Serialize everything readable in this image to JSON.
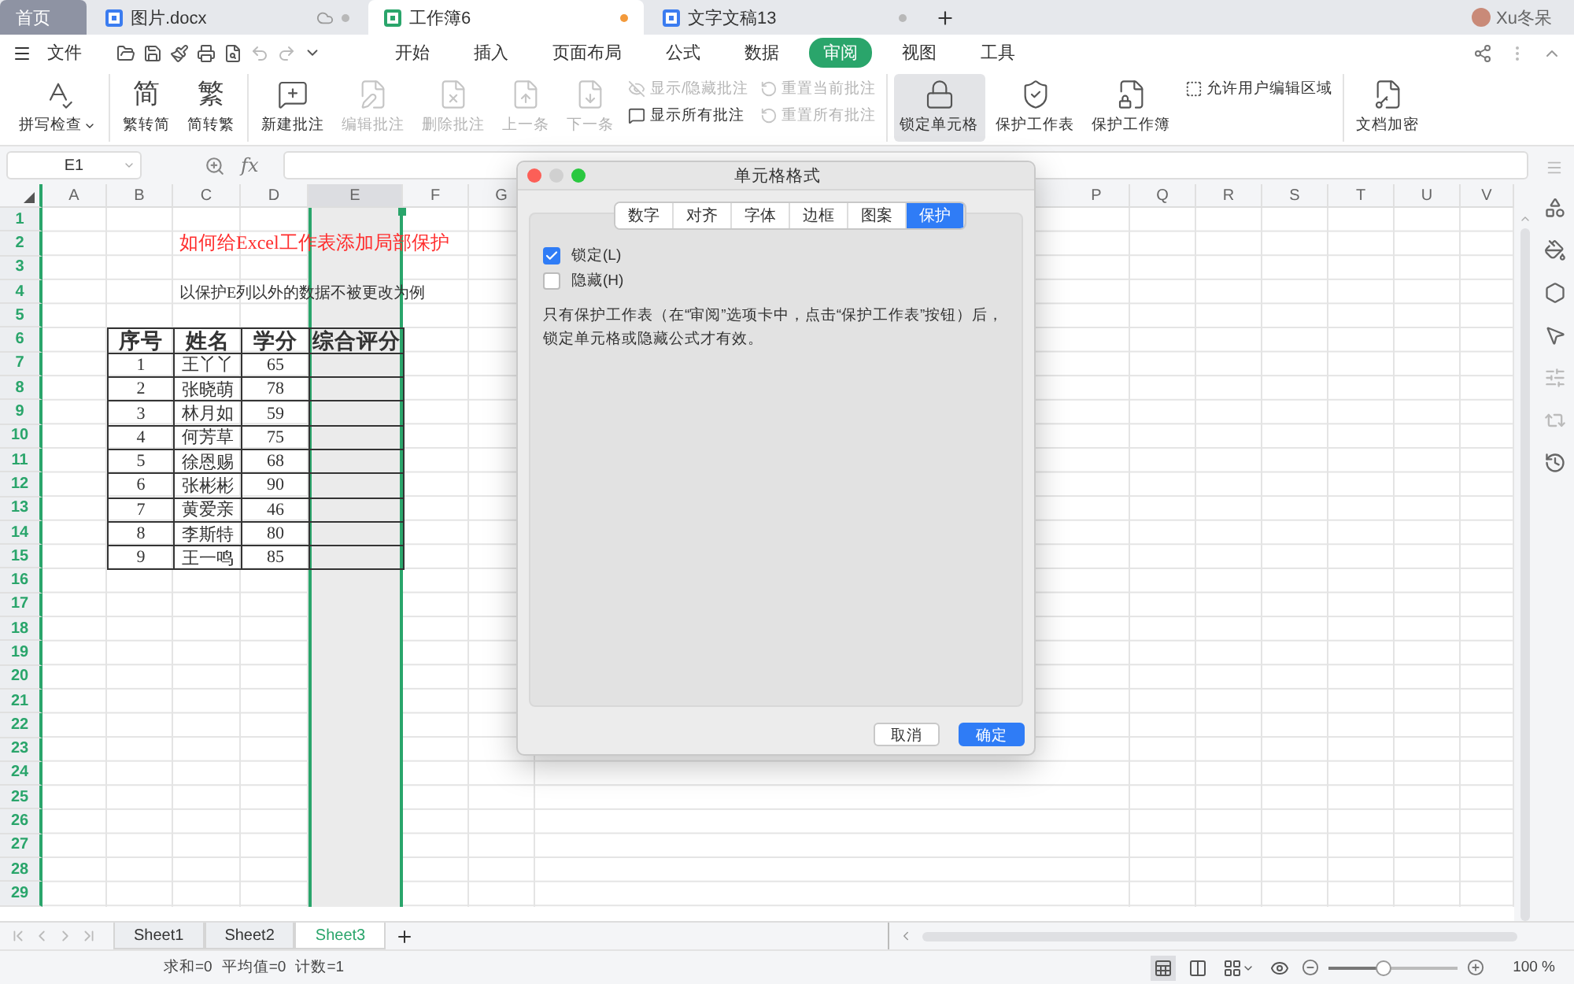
{
  "tabs": [
    {
      "label": "首页",
      "kind": "home",
      "selected": false
    },
    {
      "label": "图片.docx",
      "kind": "doc",
      "selected": false,
      "cloud": true,
      "modified": false
    },
    {
      "label": "工作簿6",
      "kind": "sheet",
      "selected": true,
      "cloud": false,
      "modified": true
    },
    {
      "label": "文字文稿13",
      "kind": "doc",
      "selected": false,
      "cloud": false,
      "modified": false
    }
  ],
  "user": {
    "name": "Xu冬呆"
  },
  "menu": {
    "file": "文件",
    "items": [
      {
        "label": "开始",
        "selected": false
      },
      {
        "label": "插入",
        "selected": false
      },
      {
        "label": "页面布局",
        "selected": false
      },
      {
        "label": "公式",
        "selected": false
      },
      {
        "label": "数据",
        "selected": false
      },
      {
        "label": "审阅",
        "selected": true
      },
      {
        "label": "视图",
        "selected": false
      },
      {
        "label": "工具",
        "selected": false
      }
    ]
  },
  "ribbon": {
    "groups": [
      {
        "items": [
          {
            "kind": "large",
            "label": "拼写检查",
            "dropdown": true,
            "disabled": false,
            "selected": false
          }
        ]
      },
      {
        "items": [
          {
            "kind": "glyph",
            "glyph": "简",
            "label": "繁转简",
            "disabled": false,
            "selected": false
          },
          {
            "kind": "glyph",
            "glyph": "繁",
            "label": "简转繁",
            "disabled": false,
            "selected": false
          }
        ]
      },
      {
        "items": [
          {
            "kind": "large",
            "label": "新建批注",
            "disabled": false,
            "selected": false
          },
          {
            "kind": "large",
            "label": "编辑批注",
            "disabled": true,
            "selected": false
          },
          {
            "kind": "large",
            "label": "删除批注",
            "disabled": true,
            "selected": false
          },
          {
            "kind": "large",
            "label": "上一条",
            "disabled": true,
            "selected": false
          },
          {
            "kind": "large",
            "label": "下一条",
            "disabled": true,
            "selected": false
          },
          {
            "kind": "stack",
            "items": [
              {
                "label": "显示/隐藏批注",
                "disabled": true
              },
              {
                "label": "显示所有批注",
                "disabled": false
              }
            ]
          },
          {
            "kind": "stack",
            "items": [
              {
                "label": "重置当前批注",
                "disabled": true
              },
              {
                "label": "重置所有批注",
                "disabled": true
              }
            ]
          }
        ]
      },
      {
        "items": [
          {
            "kind": "large",
            "label": "锁定单元格",
            "disabled": false,
            "selected": true
          },
          {
            "kind": "large",
            "label": "保护工作表",
            "disabled": false,
            "selected": false
          },
          {
            "kind": "large",
            "label": "保护工作簿",
            "disabled": false,
            "selected": false
          },
          {
            "kind": "stack",
            "items": [
              {
                "label": "允许用户编辑区域",
                "disabled": false
              }
            ]
          }
        ]
      },
      {
        "items": [
          {
            "kind": "large",
            "label": "文档加密",
            "disabled": false,
            "selected": false
          }
        ]
      }
    ]
  },
  "formula_bar": {
    "cell": "E1",
    "fx": "fx"
  },
  "sheet": {
    "columns_left": [
      {
        "label": "A",
        "selected": false
      },
      {
        "label": "B",
        "selected": false
      },
      {
        "label": "C",
        "selected": false
      },
      {
        "label": "D",
        "selected": false
      },
      {
        "label": "E",
        "selected": true
      },
      {
        "label": "F",
        "selected": false
      },
      {
        "label": "G",
        "selected": false
      }
    ],
    "columns_right": [
      {
        "label": "P",
        "selected": false
      },
      {
        "label": "Q",
        "selected": false
      },
      {
        "label": "R",
        "selected": false
      },
      {
        "label": "S",
        "selected": false
      },
      {
        "label": "T",
        "selected": false
      },
      {
        "label": "U",
        "selected": false
      },
      {
        "label": "V",
        "selected": false
      }
    ],
    "rows": [
      "1",
      "2",
      "3",
      "4",
      "5",
      "6",
      "7",
      "8",
      "9",
      "10",
      "11",
      "12",
      "13",
      "14",
      "15",
      "16",
      "17",
      "18",
      "19",
      "20",
      "21",
      "22",
      "23",
      "24",
      "25",
      "26",
      "27",
      "28",
      "29"
    ],
    "title": "如何给Excel工作表添加局部保护",
    "note": "以保护E列以外的数据不被更改为例",
    "table": {
      "header": [
        "序号",
        "姓名",
        "学分",
        "综合评分"
      ],
      "rows": [
        [
          "1",
          "王丫丫",
          "65"
        ],
        [
          "2",
          "张晓萌",
          "78"
        ],
        [
          "3",
          "林月如",
          "59"
        ],
        [
          "4",
          "何芳草",
          "75"
        ],
        [
          "5",
          "徐恩赐",
          "68"
        ],
        [
          "6",
          "张彬彬",
          "90"
        ],
        [
          "7",
          "黄爱亲",
          "46"
        ],
        [
          "8",
          "李斯特",
          "80"
        ],
        [
          "9",
          "王一鸣",
          "85"
        ]
      ]
    }
  },
  "sheet_tabs": [
    {
      "label": "Sheet1",
      "selected": false
    },
    {
      "label": "Sheet2",
      "selected": false
    },
    {
      "label": "Sheet3",
      "selected": true
    }
  ],
  "status": {
    "stats": [
      "求和=0",
      "平均值=0",
      "计数=1"
    ],
    "zoom": {
      "level": 0.42,
      "reading": "100 %"
    }
  },
  "dialog": {
    "title": "单元格格式",
    "tabs": [
      {
        "label": "数字",
        "selected": false
      },
      {
        "label": "对齐",
        "selected": false
      },
      {
        "label": "字体",
        "selected": false
      },
      {
        "label": "边框",
        "selected": false
      },
      {
        "label": "图案",
        "selected": false
      },
      {
        "label": "保护",
        "selected": true
      }
    ],
    "options": [
      {
        "label": "锁定(L)",
        "checked": true
      },
      {
        "label": "隐藏(H)",
        "checked": false
      }
    ],
    "text": "只有保护工作表（在“审阅”选项卡中，点击“保护工作表”按钮）后，锁定单元格或隐藏公式才有效。",
    "buttons": [
      {
        "label": "取消",
        "default": false
      },
      {
        "label": "确定",
        "default": true
      }
    ]
  }
}
